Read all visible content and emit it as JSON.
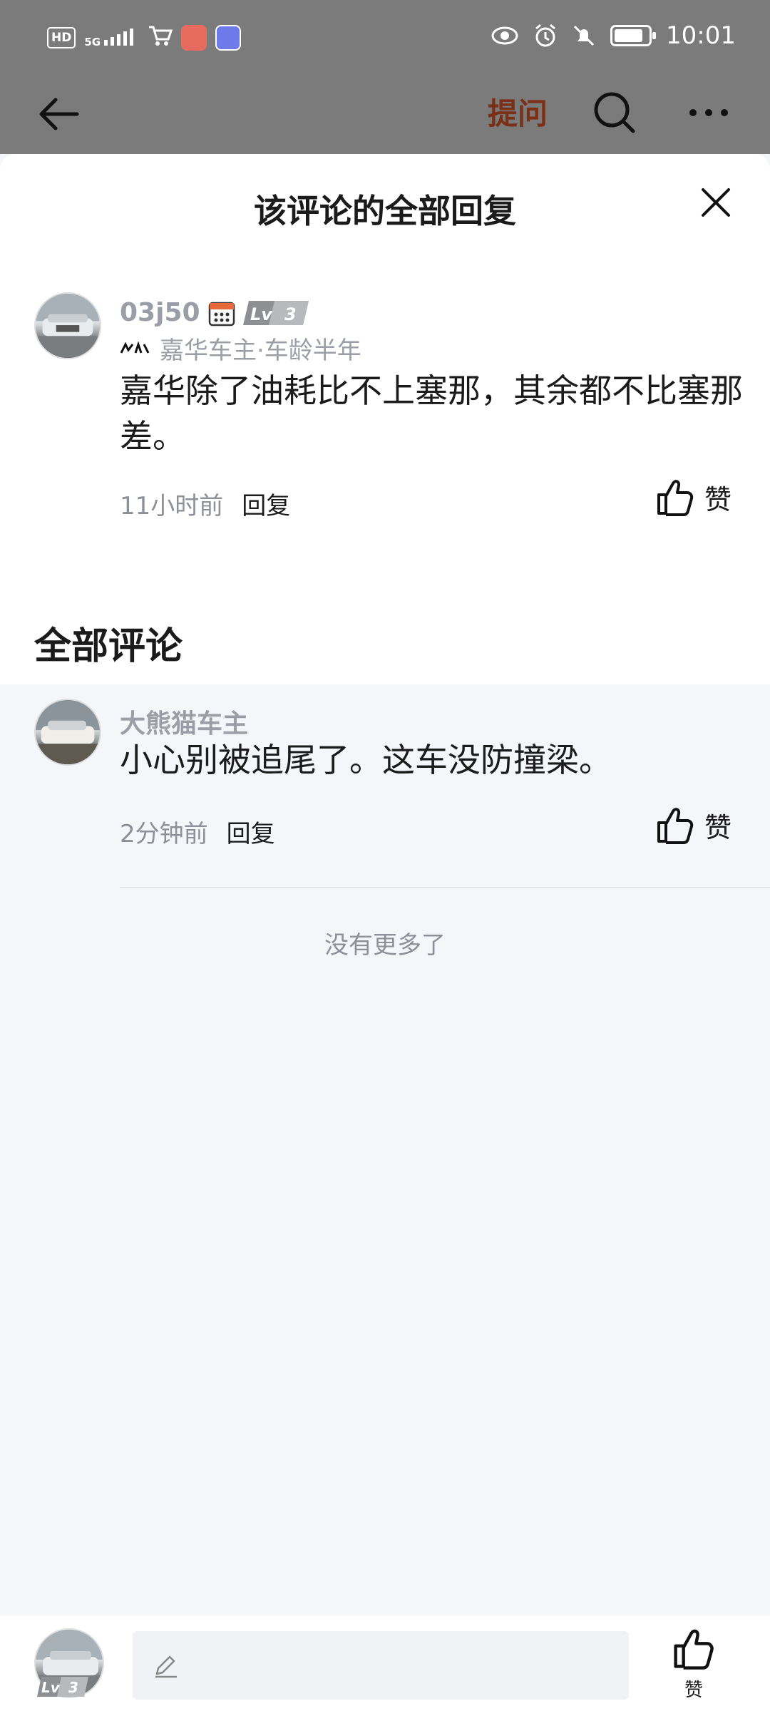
{
  "status_bar": {
    "network": "HD",
    "signal": "5G",
    "time": "10:01",
    "battery_level": 0.85,
    "icons": [
      "hd-icon",
      "signal-icon",
      "cart-icon",
      "app-icon",
      "music-icon",
      "eye-icon",
      "alarm-icon",
      "mute-icon",
      "battery-icon"
    ]
  },
  "header": {
    "ask_label": "提问",
    "ask_color": "#7a2f17"
  },
  "sheet": {
    "title": "该评论的全部回复"
  },
  "main_comment": {
    "username": "03j50",
    "level": "3",
    "level_prefix": "Lv",
    "owner": "嘉华车主·车龄半年",
    "text": "嘉华除了油耗比不上塞那，其余都不比塞那差。",
    "time": "11小时前",
    "reply_label": "回复",
    "like_label": "赞"
  },
  "all_comments": {
    "title": "全部评论",
    "items": [
      {
        "username": "大熊猫车主",
        "text": "小心别被追尾了。这车没防撞梁。",
        "time": "2分钟前",
        "reply_label": "回复",
        "like_label": "赞"
      }
    ],
    "end_text": "没有更多了"
  },
  "bottom_bar": {
    "self_level": "3",
    "self_level_prefix": "Lv",
    "like_label": "赞"
  }
}
